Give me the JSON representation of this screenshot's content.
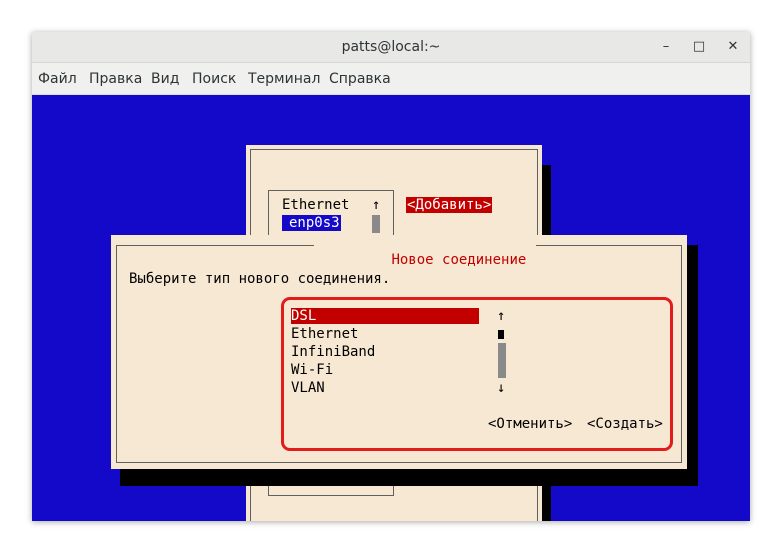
{
  "window": {
    "title": "patts@local:~"
  },
  "menu": [
    "Файл",
    "Правка",
    "Вид",
    "Поиск",
    "Терминал",
    "Справка"
  ],
  "bg_dialog": {
    "list_header": "Ethernet",
    "list_item": "enp0s3",
    "add_button": "<Добавить>",
    "scroll_up": "↑"
  },
  "dialog": {
    "title": "Новое соединение",
    "prompt": "Выберите тип нового соединения.",
    "types": [
      "DSL",
      "Ethernet",
      "InfiniBand",
      "Wi-Fi",
      "VLAN"
    ],
    "selected": "DSL",
    "scroll_up": "↑",
    "scroll_down": "↓",
    "cancel": "<Отменить>",
    "create": "<Создать>"
  },
  "colors": {
    "terminal_bg": "#1409c8",
    "dialog_bg": "#f7e8d3",
    "highlight": "#c20000",
    "annotation": "#e21b1b"
  }
}
